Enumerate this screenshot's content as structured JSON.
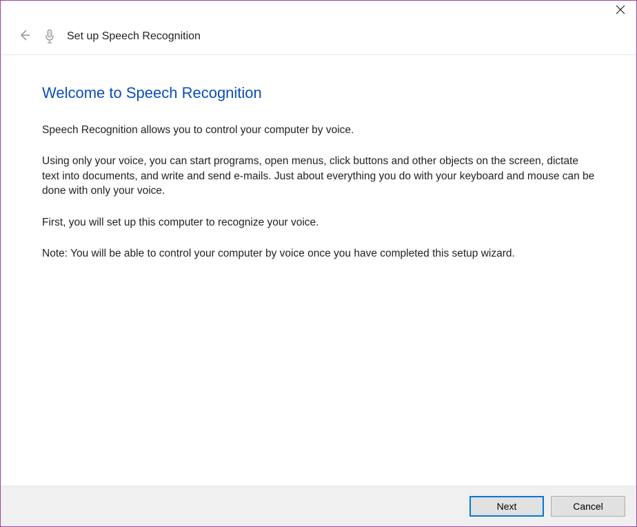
{
  "titlebar": {
    "close_label": "Close"
  },
  "header": {
    "back_label": "Back",
    "title": "Set up Speech Recognition"
  },
  "content": {
    "heading": "Welcome to Speech Recognition",
    "paragraphs": [
      "Speech Recognition allows you to control your computer by voice.",
      "Using only your voice, you can start programs, open menus, click buttons and other objects on the screen, dictate text into documents, and write and send e-mails. Just about everything you do with your keyboard and mouse can be done with only your voice.",
      "First, you will set up this computer to recognize your voice.",
      "Note: You will be able to control your computer by voice once you have completed this setup wizard."
    ]
  },
  "footer": {
    "next_label": "Next",
    "cancel_label": "Cancel"
  },
  "colors": {
    "accent": "#0078d7",
    "heading": "#0b4db8"
  }
}
